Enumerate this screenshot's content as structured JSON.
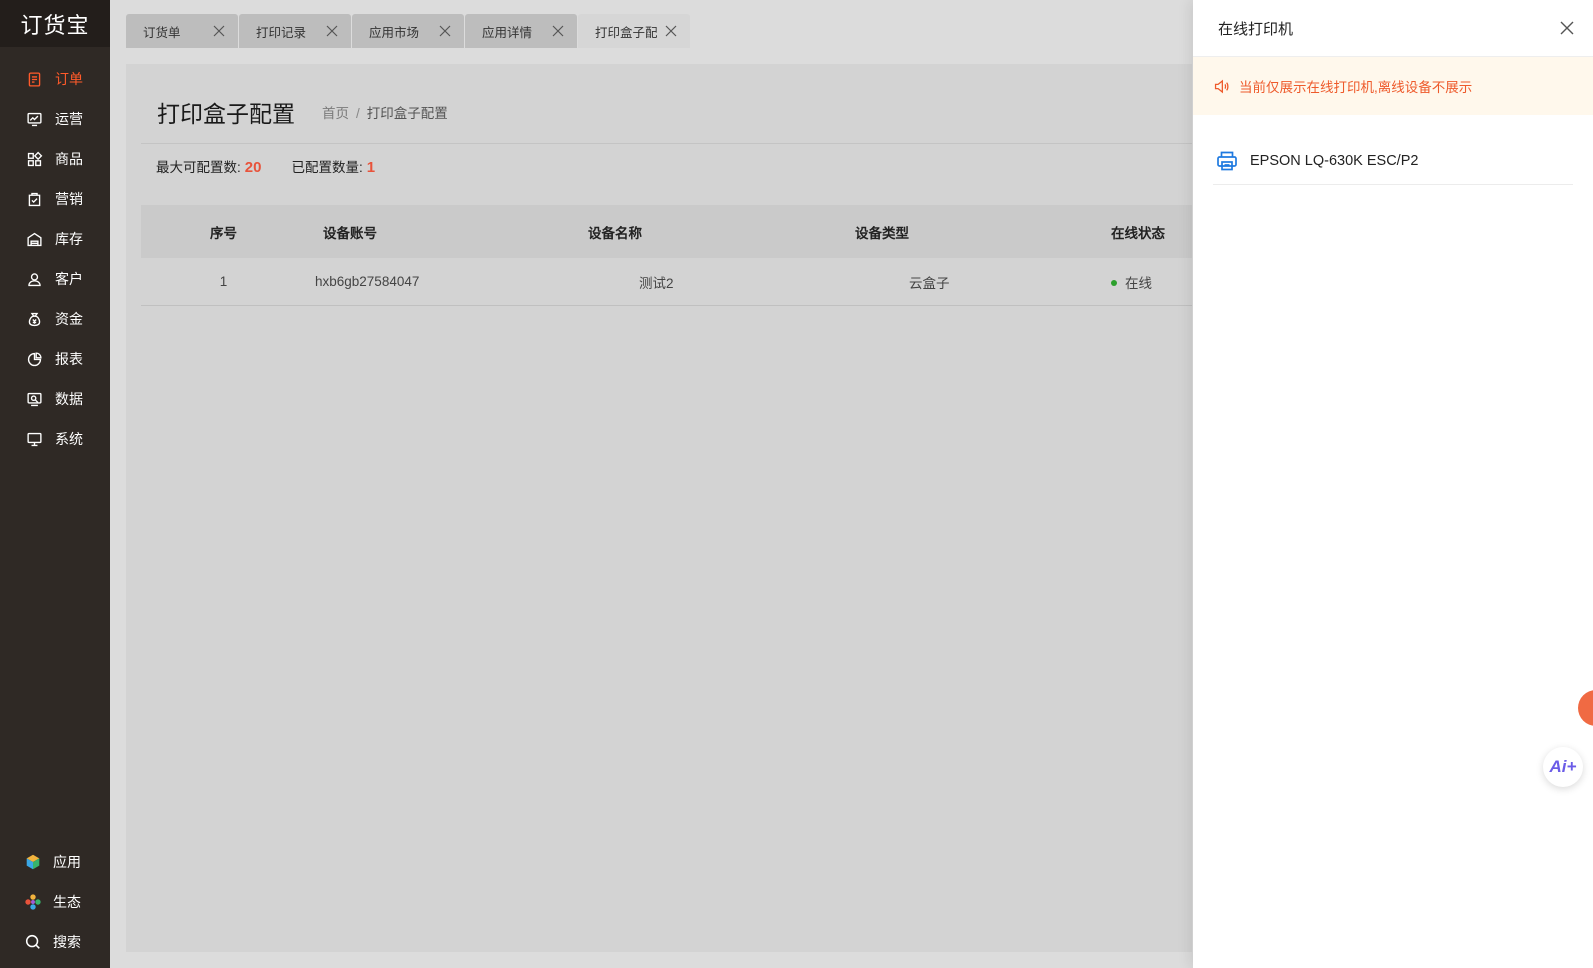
{
  "app": {
    "logo": "订货宝"
  },
  "sidebar": {
    "items": [
      {
        "label": "订单",
        "icon": "order-icon",
        "active": true
      },
      {
        "label": "运营",
        "icon": "operation-icon"
      },
      {
        "label": "商品",
        "icon": "goods-icon"
      },
      {
        "label": "营销",
        "icon": "marketing-icon"
      },
      {
        "label": "库存",
        "icon": "warehouse-icon"
      },
      {
        "label": "客户",
        "icon": "user-icon"
      },
      {
        "label": "资金",
        "icon": "money-bag-icon"
      },
      {
        "label": "报表",
        "icon": "pie-chart-icon"
      },
      {
        "label": "数据",
        "icon": "data-icon"
      },
      {
        "label": "系统",
        "icon": "monitor-icon"
      }
    ],
    "bottom": [
      {
        "label": "应用",
        "icon": "app-cube-icon"
      },
      {
        "label": "生态",
        "icon": "ecosystem-flower-icon"
      },
      {
        "label": "搜索",
        "icon": "search-icon"
      }
    ]
  },
  "tabs": [
    {
      "label": "订货单"
    },
    {
      "label": "打印记录"
    },
    {
      "label": "应用市场"
    },
    {
      "label": "应用详情"
    },
    {
      "label": "打印盒子配置",
      "active": true
    }
  ],
  "page": {
    "title": "打印盒子配置",
    "breadcrumb": {
      "home": "首页",
      "sep": "/",
      "current": "打印盒子配置"
    },
    "stats": {
      "max_label": "最大可配置数:",
      "max_value": "20",
      "configured_label": "已配置数量:",
      "configured_value": "1"
    }
  },
  "table": {
    "headers": [
      "序号",
      "设备账号",
      "设备名称",
      "设备类型",
      "在线状态"
    ],
    "rows": [
      {
        "index": "1",
        "account": "hxb6gb27584047",
        "name": "测试2",
        "type": "云盒子",
        "status": "在线"
      }
    ]
  },
  "drawer": {
    "title": "在线打印机",
    "notice": "当前仅展示在线打印机,离线设备不展示",
    "printers": [
      {
        "name": "EPSON LQ-630K ESC/P2"
      }
    ]
  },
  "float": {
    "ai_label": "Ai+"
  },
  "colors": {
    "accent": "#ff5a2a",
    "sidebar_bg": "#2f2925",
    "notice_text": "#ee5a2b",
    "online_dot": "#2ca02c",
    "printer_icon": "#1f7ae0"
  }
}
